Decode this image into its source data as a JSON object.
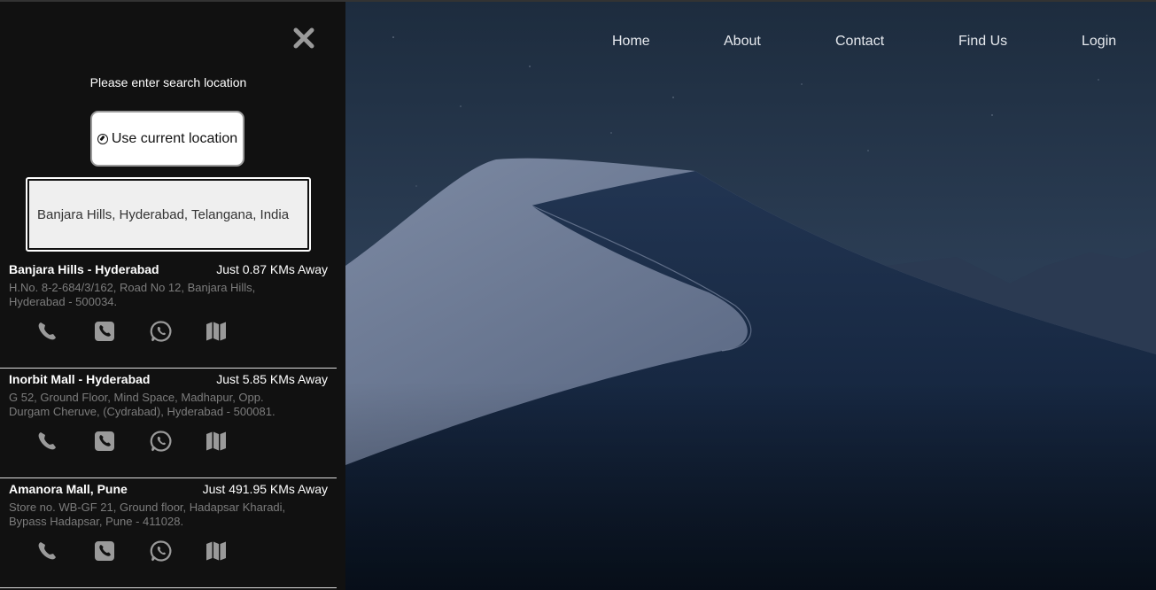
{
  "nav": {
    "items": [
      {
        "label": "Home"
      },
      {
        "label": "About"
      },
      {
        "label": "Contact"
      },
      {
        "label": "Find Us"
      },
      {
        "label": "Login"
      }
    ]
  },
  "panel": {
    "close_icon": "close-icon",
    "prompt": "Please enter search location",
    "use_location_label": "Use current location",
    "location_icon": "compass-icon",
    "search_value": "Banjara Hills, Hyderabad, Telangana, India",
    "stores": [
      {
        "name": "Banjara Hills - Hyderabad",
        "distance": "Just 0.87 KMs Away",
        "address": "H.No. 8-2-684/3/162, Road No 12, Banjara Hills, Hyderabad - 500034."
      },
      {
        "name": "Inorbit Mall - Hyderabad",
        "distance": "Just 5.85 KMs Away",
        "address": "G 52, Ground Floor, Mind Space, Madhapur, Opp. Durgam Cheruve, (Cydrabad), Hyderabad - 500081."
      },
      {
        "name": "Amanora Mall, Pune",
        "distance": "Just 491.95 KMs Away",
        "address": "Store no. WB-GF 21, Ground floor, Hadapsar Kharadi, Bypass Hadapsar, Pune - 411028."
      }
    ],
    "store_action_icons": [
      "phone-icon",
      "phone-square-icon",
      "whatsapp-icon",
      "map-icon"
    ]
  },
  "colors": {
    "panel_bg": "#111111",
    "address_text": "#7c7c7c",
    "icon_gray": "#9a9a9a"
  }
}
